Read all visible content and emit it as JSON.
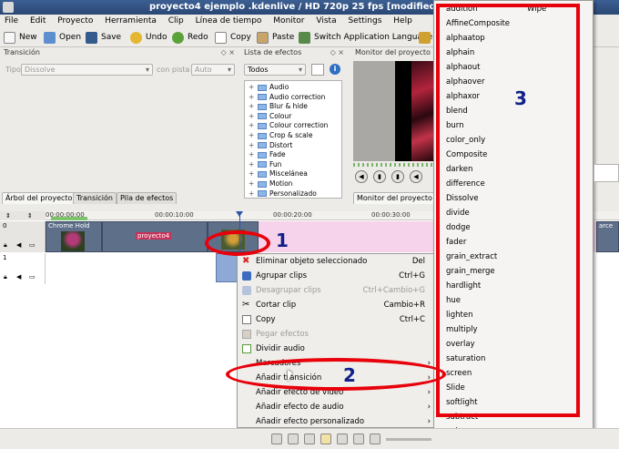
{
  "window": {
    "title": "proyecto4 ejemplo .kdenlive / HD 720p 25 fps [modified] - Kde"
  },
  "menu": [
    "File",
    "Edit",
    "Proyecto",
    "Herramienta",
    "Clip",
    "Línea de tiempo",
    "Monitor",
    "Vista",
    "Settings",
    "Help"
  ],
  "toolbar": {
    "new": "New",
    "open": "Open",
    "save": "Save",
    "undo": "Undo",
    "redo": "Redo",
    "copy": "Copy",
    "paste": "Paste",
    "switch_language": "Switch Application Language"
  },
  "transition_panel": {
    "title": "Transición",
    "tipo_label": "Tipo",
    "tipo_value": "Dissolve",
    "con_pista_label": "con pista",
    "con_pista_value": "Auto"
  },
  "effects_panel": {
    "title": "Lista de efectos",
    "filter_value": "Todos",
    "items": [
      "Audio",
      "Audio correction",
      "Blur & hide",
      "Colour",
      "Colour correction",
      "Crop & scale",
      "Distort",
      "Fade",
      "Fun",
      "Miscelánea",
      "Motion",
      "Personalizado"
    ]
  },
  "monitor_panel": {
    "title": "Monitor del proyecto"
  },
  "tabs": {
    "arbol": "Árbol del proyecto",
    "transicion": "Transición",
    "pila": "Pila de efectos",
    "monitor_proyecto": "Monitor del proyecto"
  },
  "ruler": {
    "t0": "00:00:00:00",
    "t1": "00:00:10:00",
    "t2": "00:00:20:00",
    "t3": "00:00:30:00"
  },
  "tracks": {
    "track0_label": "0",
    "track1_label": "1",
    "clip_chroma": "Chrome Hold",
    "clip_proyecto": "proyecto4",
    "clip_right": "arce"
  },
  "context_menu": {
    "items": [
      {
        "label": "Eliminar objeto seleccionado",
        "shortcut": "Del",
        "disabled": false,
        "submenu": false
      },
      {
        "label": "Agrupar clips",
        "shortcut": "Ctrl+G",
        "disabled": false,
        "submenu": false
      },
      {
        "label": "Desagrupar clips",
        "shortcut": "Ctrl+Cambio+G",
        "disabled": true,
        "submenu": false
      },
      {
        "label": "Cortar clip",
        "shortcut": "Cambio+R",
        "disabled": false,
        "submenu": false
      },
      {
        "label": "Copy",
        "shortcut": "Ctrl+C",
        "disabled": false,
        "submenu": false
      },
      {
        "label": "Pegar efectos",
        "shortcut": "",
        "disabled": true,
        "submenu": false
      },
      {
        "label": "Dividir audio",
        "shortcut": "",
        "disabled": false,
        "submenu": false
      },
      {
        "label": "Marcadores",
        "shortcut": "",
        "disabled": false,
        "submenu": true
      },
      {
        "label": "Añadir transición",
        "shortcut": "",
        "disabled": false,
        "submenu": true
      },
      {
        "label": "Añadir efecto de vídeo",
        "shortcut": "",
        "disabled": false,
        "submenu": true
      },
      {
        "label": "Añadir efecto de audio",
        "shortcut": "",
        "disabled": false,
        "submenu": true
      },
      {
        "label": "Añadir efecto personalizado",
        "shortcut": "",
        "disabled": false,
        "submenu": true
      }
    ]
  },
  "submenu": {
    "first": "addition",
    "first_right": "Wipe",
    "items": [
      "AffineComposite",
      "alphaatop",
      "alphain",
      "alphaout",
      "alphaover",
      "alphaxor",
      "blend",
      "burn",
      "color_only",
      "Composite",
      "darken",
      "difference",
      "Dissolve",
      "divide",
      "dodge",
      "fader",
      "grain_extract",
      "grain_merge",
      "hardlight",
      "hue",
      "lighten",
      "multiply",
      "overlay",
      "saturation",
      "screen",
      "Slide",
      "softlight",
      "subtract",
      "value"
    ]
  },
  "annotations": {
    "n1": "1",
    "n2": "2",
    "n3": "3"
  },
  "colors": {
    "annotation_red": "#e8000b",
    "annotation_number": "#111f8a",
    "title_bar": "#2f5080",
    "track_pink": "#f6d3ea"
  }
}
